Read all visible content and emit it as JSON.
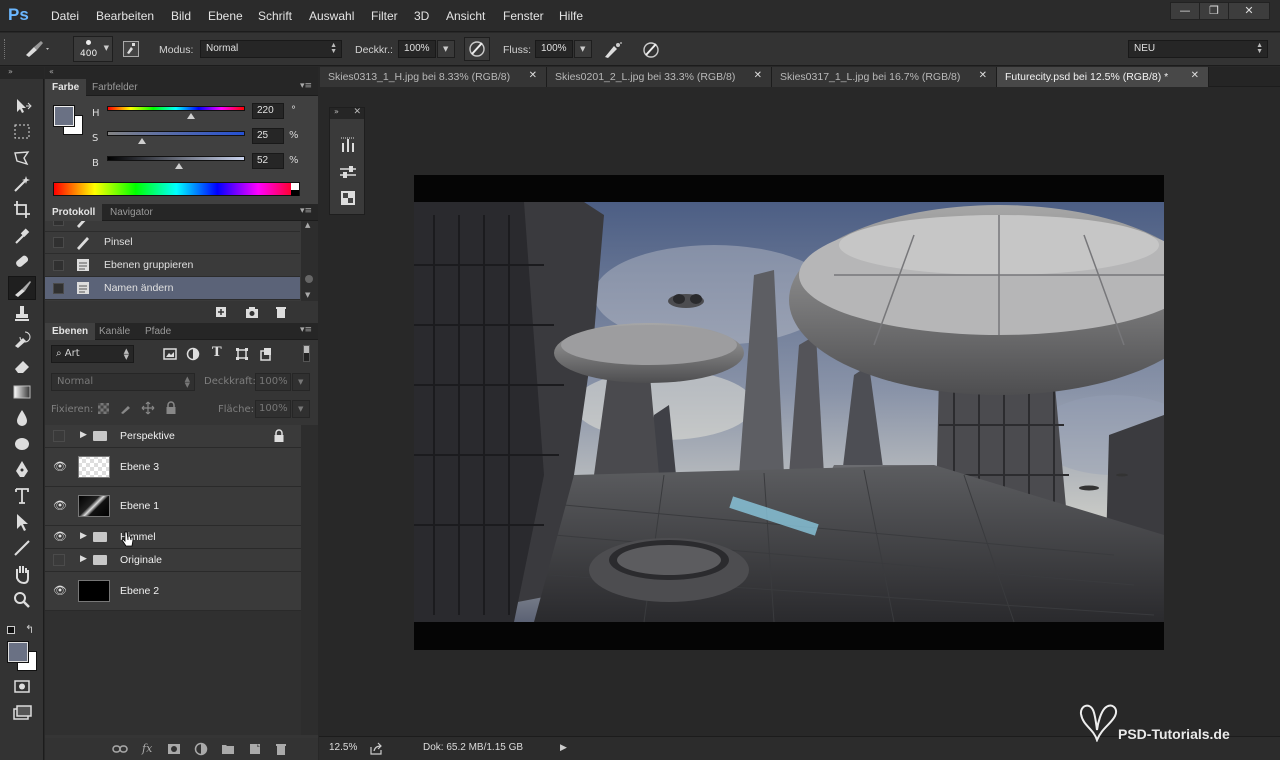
{
  "app": {
    "logo": "Ps"
  },
  "menu": [
    "Datei",
    "Bearbeiten",
    "Bild",
    "Ebene",
    "Schrift",
    "Auswahl",
    "Filter",
    "3D",
    "Ansicht",
    "Fenster",
    "Hilfe"
  ],
  "window_controls": {
    "minimize": "—",
    "restore": "❐",
    "close": "✕"
  },
  "options": {
    "brush_size": "400",
    "mode_label": "Modus:",
    "mode_value": "Normal",
    "opacity_label": "Deckkr.:",
    "opacity_value": "100%",
    "flow_label": "Fluss:",
    "flow_value": "100%",
    "workspace_value": "NEU"
  },
  "tabs": [
    {
      "label": "Skies0313_1_H.jpg bei 8.33% (RGB/8)",
      "active": false
    },
    {
      "label": "Skies0201_2_L.jpg bei 33.3% (RGB/8)",
      "active": false
    },
    {
      "label": "Skies0317_1_L.jpg bei 16.7% (RGB/8)",
      "active": false
    },
    {
      "label": "Futurecity.psd bei 12.5% (RGB/8) *",
      "active": true
    }
  ],
  "color_panel": {
    "tabs": [
      "Farbe",
      "Farbfelder"
    ],
    "h_label": "H",
    "h_value": "220",
    "h_unit": "°",
    "h_level": 0.61,
    "s_label": "S",
    "s_value": "25",
    "s_unit": "%",
    "s_level": 0.25,
    "b_label": "B",
    "b_value": "52",
    "b_unit": "%",
    "b_level": 0.52,
    "foreground_color": "#6a7184",
    "background_color": "#ffffff"
  },
  "history_panel": {
    "tabs": [
      "Protokoll",
      "Navigator"
    ],
    "items": [
      {
        "label": "Pinsel",
        "selected": false
      },
      {
        "label": "Ebenen gruppieren",
        "selected": false
      },
      {
        "label": "Namen ändern",
        "selected": true
      }
    ]
  },
  "layers_panel": {
    "tabs": [
      "Ebenen",
      "Kanäle",
      "Pfade"
    ],
    "filter_kind": "Art",
    "blend_mode": "Normal",
    "opacity_label": "Deckkraft:",
    "opacity_value": "100%",
    "lock_label": "Fixieren:",
    "fill_label": "Fläche:",
    "fill_value": "100%",
    "layers": [
      {
        "name": "Perspektive",
        "type": "group",
        "visible": false,
        "locked": true
      },
      {
        "name": "Ebene 3",
        "type": "layer",
        "visible": true,
        "thumb": "transparent"
      },
      {
        "name": "Ebene 1",
        "type": "layer",
        "visible": true,
        "thumb": "image"
      },
      {
        "name": "Himmel",
        "type": "group",
        "visible": true
      },
      {
        "name": "Originale",
        "type": "group",
        "visible": false
      },
      {
        "name": "Ebene 2",
        "type": "layer",
        "visible": true,
        "thumb": "black"
      }
    ]
  },
  "status": {
    "zoom": "12.5%",
    "doc_info": "Dok: 65.2 MB/1.15 GB"
  },
  "watermark": "PSD-Tutorials.de"
}
